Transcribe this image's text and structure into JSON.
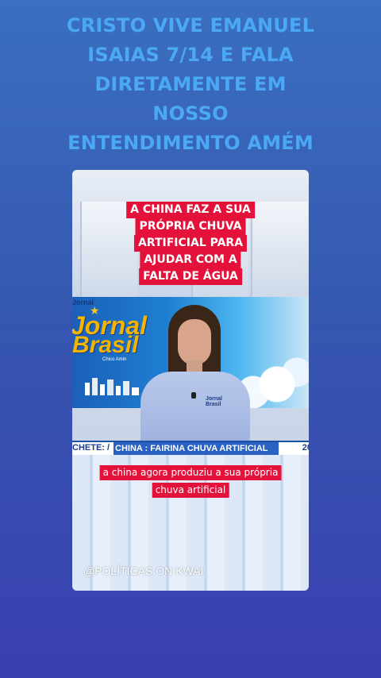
{
  "headline": {
    "lines": [
      "CRISTO VIVE EMANUEL",
      "ISAIAS 7/14 E FALA",
      "DIRETAMENTE EM",
      "NOSSO",
      "ENTENDIMENTO AMÉM"
    ]
  },
  "video": {
    "caption_top": [
      "A CHINA FAZ A SUA",
      "PRÓPRIA CHUVA",
      "ARTIFICIAL PARA",
      "AJUDAR COM A",
      "FALTA DE ÁGUA"
    ],
    "logo": {
      "small": "Jornal",
      "line1": "Jornal",
      "line2": "Brasil",
      "sub": "Chico Amin"
    },
    "shirt_logo": [
      "Jornal",
      "Brasil"
    ],
    "ticker": {
      "label": "CHETE:",
      "slash": "/",
      "text": "CHINA : FAIRINA CHUVA ARTIFICIAL",
      "year": "20"
    },
    "caption_bottom": [
      "a china agora produziu a sua própria",
      "chuva artificial"
    ],
    "watermark": "@POLÍTICAS ON  KWAI"
  },
  "colors": {
    "background_top": "#3b6fc0",
    "background_bottom": "#3a3fb0",
    "headline_text": "#4aa8f5",
    "caption_red": "#e4123a",
    "logo_gold": "#f5b400"
  }
}
